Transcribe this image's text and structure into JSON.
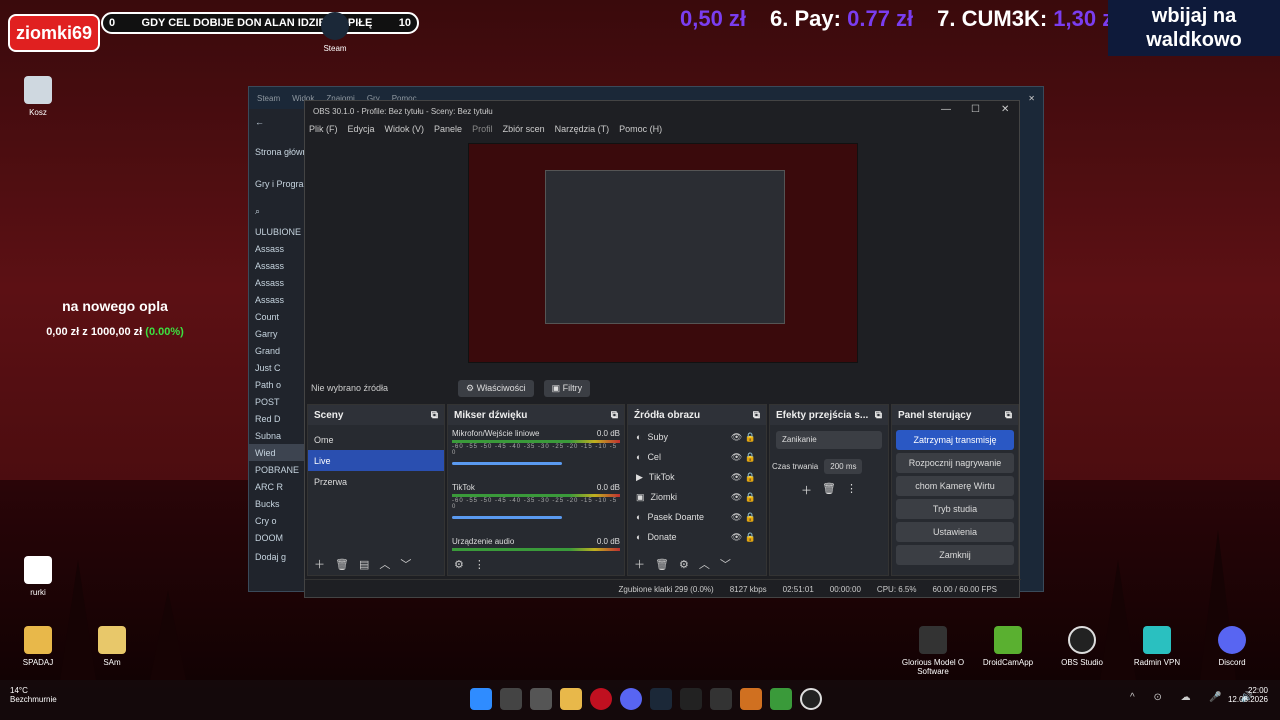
{
  "overlay": {
    "badge": "ziomki69",
    "goal_left": "0",
    "goal_text": "GDY CEL DOBIJE DON ALAN IDZIE PO PIŁĘ",
    "goal_right": "10",
    "ticker": [
      {
        "label": "",
        "amt": "0,50 zł"
      },
      {
        "label": "6. Pay:",
        "amt": "0.77 zł"
      },
      {
        "label": "7. CUM3K:",
        "amt": "1,30 zł"
      }
    ],
    "waldkowo": "wbijaj na waldkowo",
    "donate_title": "na nowego opla",
    "donate_current": "0,00 zł",
    "donate_z": "z",
    "donate_goal": "1000,00 zł",
    "donate_pct": "(0.00%)"
  },
  "desktop": {
    "icons": [
      {
        "name": "Steam"
      },
      {
        "name": "Kosz"
      },
      {
        "name": "rurki"
      },
      {
        "name": "SPADAJ"
      },
      {
        "name": "SAm"
      },
      {
        "name": "Glorious Model O Software"
      },
      {
        "name": "DroidCamApp"
      },
      {
        "name": "OBS Studio"
      },
      {
        "name": "Radmin VPN"
      },
      {
        "name": "Discord"
      }
    ]
  },
  "steam": {
    "title": "Steam",
    "menu": [
      "Widok",
      "Znajomi",
      "Gry",
      "Pomoc"
    ],
    "nav": "Strona główna",
    "filter": "Gry i Programy",
    "section_fav": "ULUBIONE",
    "section_dl": "POBRANE",
    "items": [
      "Assass",
      "Assass",
      "Assass",
      "Assass",
      "Count",
      "Garry",
      "Grand",
      "Just C",
      "Path o",
      "POST",
      "Red D",
      "Subna",
      "Wied"
    ],
    "dl_items": [
      "ARC R",
      "Bucks",
      "Cry o",
      "DOOM"
    ],
    "add": "Dodaj g"
  },
  "obs": {
    "title": "OBS 30.1.0 - Profile: Bez tytułu - Sceny: Bez tytułu",
    "menu": [
      "Plik (F)",
      "Edycja",
      "Widok (V)",
      "Panele",
      "Profil",
      "Zbiór scen",
      "Narzędzia (T)",
      "Pomoc (H)"
    ],
    "no_source": "Nie wybrano źródła",
    "props": "Właściwości",
    "filters": "Filtry",
    "scenes_title": "Sceny",
    "scenes": [
      "Ome",
      "Live",
      "Przerwa"
    ],
    "mixer_title": "Mikser dźwięku",
    "mixer": [
      {
        "name": "Mikrofon/Wejście liniowe",
        "db": "0.0 dB"
      },
      {
        "name": "TikTok",
        "db": "0.0 dB"
      },
      {
        "name": "Urządzenie audio",
        "db": "0.0 dB"
      }
    ],
    "scale": "-60 -55 -50 -45 -40 -35 -30 -25 -20 -15 -10 -5 0",
    "sources_title": "Źródła obrazu",
    "sources": [
      "Suby",
      "Cel",
      "TikTok",
      "Ziomki",
      "Pasek Doante",
      "Donate"
    ],
    "trans_title": "Efekty przejścia s...",
    "trans_type": "Zanikanie",
    "trans_dur_label": "Czas trwania",
    "trans_dur": "200 ms",
    "ctrl_title": "Panel sterujący",
    "ctrl": [
      "Zatrzymaj transmisję",
      "Rozpocznij nagrywanie",
      "chom Kamerę Wirtu",
      "Tryb studia",
      "Ustawienia",
      "Zamknij"
    ],
    "status": {
      "dropped": "Zgubione klatki 299 (0.0%)",
      "kbps": "8127 kbps",
      "live": "02:51:01",
      "rec": "00:00:00",
      "cpu": "CPU: 6.5%",
      "fps": "60.00 / 60.00 FPS"
    }
  },
  "tray": {
    "temp": "14°C",
    "weather": "Bezchmurnie",
    "time": "22:00",
    "date": "12.08.2026"
  }
}
